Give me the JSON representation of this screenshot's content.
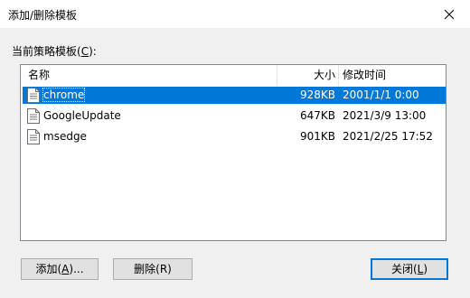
{
  "window": {
    "title": "添加/删除模板",
    "close_glyph": "✕"
  },
  "section": {
    "label_prefix": "当前策略模板(",
    "label_accel": "C",
    "label_suffix": "):"
  },
  "list": {
    "columns": {
      "name": "名称",
      "size": "大小",
      "modified": "修改时间"
    },
    "rows": [
      {
        "name": "chrome",
        "size": "928KB",
        "modified": "2001/1/1 0:00",
        "selected": true,
        "icon": "document-icon"
      },
      {
        "name": "GoogleUpdate",
        "size": "647KB",
        "modified": "2021/3/9 13:00",
        "selected": false,
        "icon": "document-icon"
      },
      {
        "name": "msedge",
        "size": "901KB",
        "modified": "2021/2/25 17:52",
        "selected": false,
        "icon": "document-icon"
      }
    ]
  },
  "buttons": {
    "add_prefix": "添加(",
    "add_accel": "A",
    "add_suffix": ")...",
    "delete_label": "删除(R)",
    "close_prefix": "关闭(",
    "close_accel": "L",
    "close_suffix": ")"
  },
  "colors": {
    "selection": "#0078d7",
    "dialog_bg": "#f0f0f0",
    "border": "#828790"
  }
}
